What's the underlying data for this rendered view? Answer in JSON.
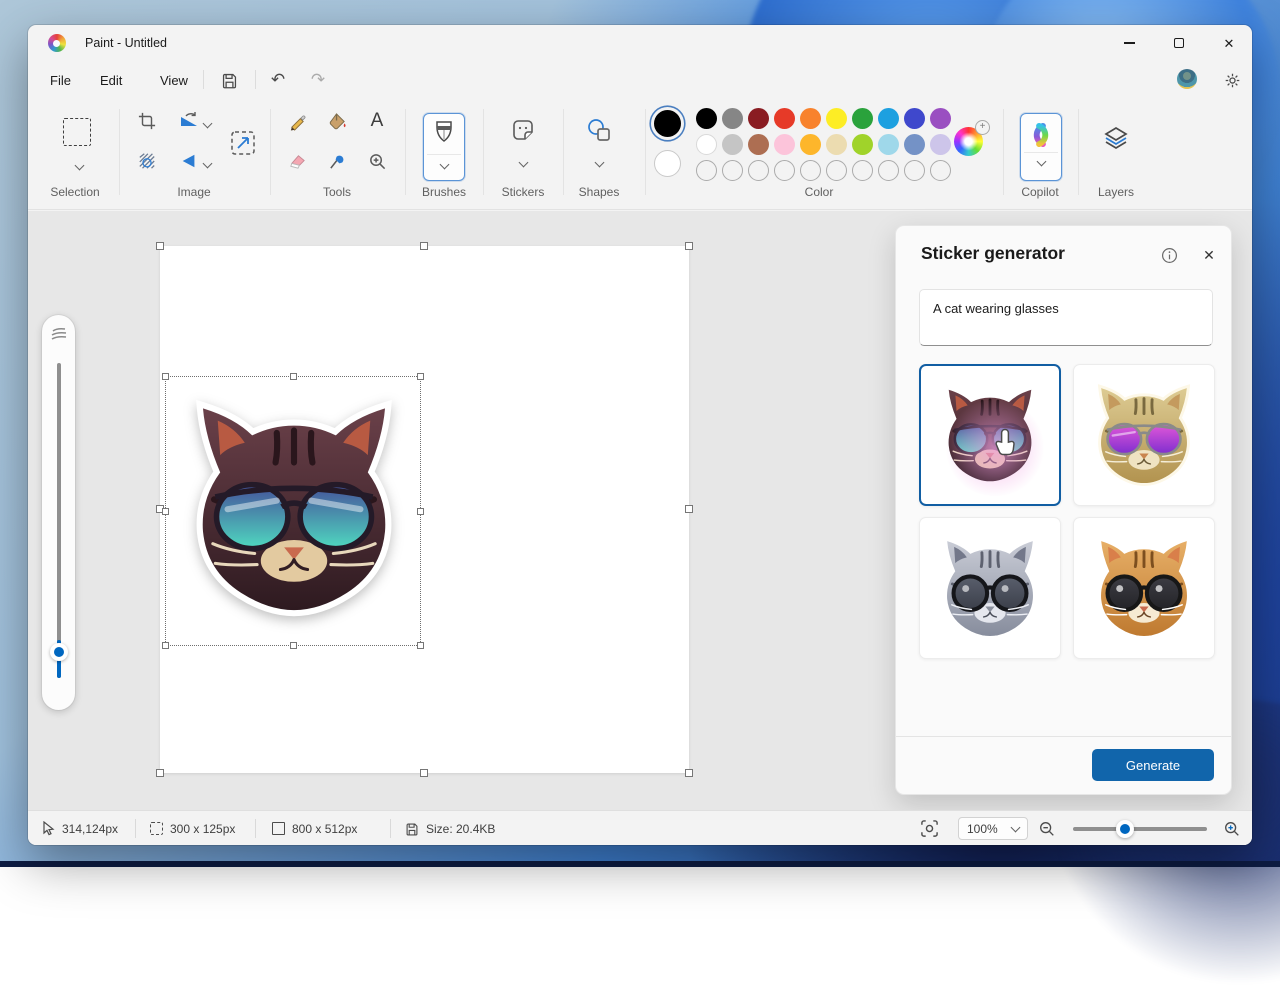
{
  "window": {
    "title": "Paint - Untitled"
  },
  "menubar": {
    "items": [
      "File",
      "Edit",
      "View"
    ]
  },
  "ribbon": {
    "group_labels": [
      "Selection",
      "Image",
      "Tools",
      "Brushes",
      "Stickers",
      "Shapes",
      "Color",
      "Copilot",
      "Layers"
    ],
    "selected_color": "#000000",
    "secondary_color": "#ffffff",
    "palette": [
      "#000000",
      "#868686",
      "#8a1c22",
      "#e63a28",
      "#f8822c",
      "#fded25",
      "#2aa23c",
      "#1da0e0",
      "#3f48cc",
      "#9a4fc1",
      "#ffffff",
      "#c5c5c5",
      "#ad6e52",
      "#fcc4da",
      "#fdb62b",
      "#ecdcb0",
      "#a0d32a",
      "#9fd8ea",
      "#7492c6",
      "#cdc5ea"
    ]
  },
  "sticker_panel": {
    "title": "Sticker generator",
    "prompt": "A cat wearing glasses",
    "generate_label": "Generate",
    "thumbnails": [
      {
        "name": "dark-cat-teal-sunglasses",
        "selected": true
      },
      {
        "name": "tabby-cat-purple-aviators",
        "selected": false
      },
      {
        "name": "gray-cat-round-glasses",
        "selected": false
      },
      {
        "name": "orange-kitten-round-glasses",
        "selected": false
      }
    ]
  },
  "statusbar": {
    "cursor_pos": "314,124px",
    "selection_size": "300 x 125px",
    "canvas_size": "800 x 512px",
    "file_size": "Size: 20.4KB",
    "zoom_value": "100%"
  },
  "colors": {
    "accent_blue": "#1165ab",
    "thumb_blue": "#0067c0",
    "tile_outline": "#5b94d6"
  }
}
